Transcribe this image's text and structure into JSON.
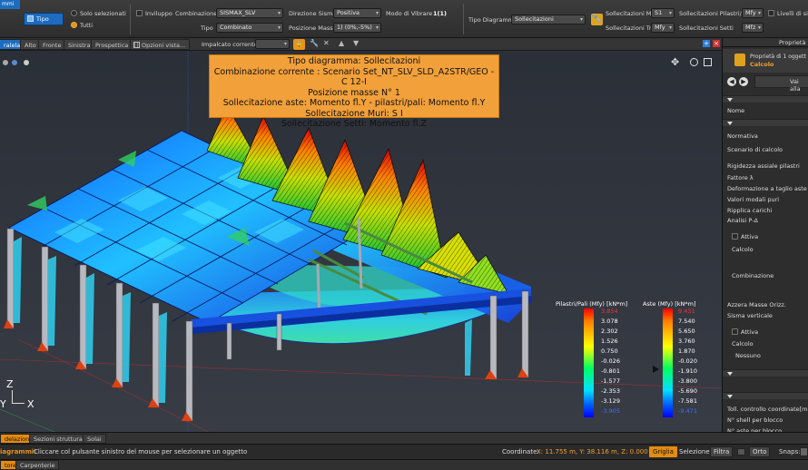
{
  "ribbon": {
    "corner_tab": "mmi",
    "tipo_button": "Tipo",
    "solo_selezionati": "Solo selezionati",
    "tutti": "Tutti",
    "inviluppo": "Inviluppo",
    "combinazione_label": "Combinazione",
    "combinazione_value": "SISMAX_SLV",
    "tipo_label": "Tipo",
    "tipo_value": "Combinato",
    "direzione_sisma_label": "Direzione Sisma",
    "direzione_sisma_value": "Positiva",
    "posizione_masse_label": "Posizione Masse",
    "posizione_masse_value": "1) (0%,-5%)",
    "modo_vibrare_label": "Modo di Vibrare",
    "modo_vibrare_value": "1(1)",
    "tipo_diagramma_label": "Tipo Diagramma",
    "tipo_diagramma_value": "Sollecitazioni",
    "sollecitazioni_muri_label": "Sollecitazioni Muri",
    "sollecitazioni_muri_value": "S1",
    "sollecitazioni_pilastri_label": "Sollecitazioni Pilastri/Pali",
    "sollecitazioni_pilastri_value": "Mfy",
    "livelli_sicurezza_label": "Livelli di sicurezz",
    "sollecitazioni_travi_label": "Sollecitazioni Travi",
    "sollecitazioni_travi_value": "Mfy",
    "sollecitazioni_setti_label": "Sollecitazioni Setti",
    "sollecitazioni_setti_value": "Mfz"
  },
  "viewbar": {
    "tabs": [
      "ralela",
      "Alto",
      "Fronte",
      "Sinistra",
      "Prospettica"
    ],
    "opzioni_vista": "Opzioni vista...",
    "impalcato_label": "Impalcato corrente:"
  },
  "infobox": {
    "lines": [
      "Tipo diagramma: Sollecitazioni",
      "Combinazione corrente : Scenario Set_NT_SLV_SLD_A2STR/GEO - C 12-I",
      "Posizione masse N° 1",
      "Sollecitazione aste: Momento fl.Y - pilastri/pali: Momento fl.Y",
      "Sollecitazione Muri: S I",
      "Sollecitazione Setti: Momento fl.Z"
    ]
  },
  "legend_pilastri": {
    "title": "Pilastri/Pali (Mfy) [kN*m]",
    "values": [
      "3.854",
      "3.078",
      "2.302",
      "1.526",
      "0.750",
      "-0.026",
      "-0.801",
      "-1.577",
      "-2.353",
      "-3.129",
      "-3.905"
    ]
  },
  "legend_aste": {
    "title": "Aste (Mfy) [kN*m]",
    "values": [
      "9.431",
      "7.540",
      "5.650",
      "3.760",
      "1.870",
      "-0.020",
      "-1.910",
      "-3.800",
      "-5.690",
      "-7.581",
      "-9.471"
    ]
  },
  "axes": {
    "z": "Z",
    "y": "Y",
    "x": "X"
  },
  "right_panel": {
    "tab": "Proprietà",
    "header_line1": "Proprietà di 1 oggett",
    "header_line2": "Calcolo",
    "vai_alla": "Vai alla",
    "rows": {
      "nome": "Nome",
      "normativa": "Normativa",
      "scenario": "Scenario di calcolo",
      "rigidezza": "Rigidezza assiale pilastri",
      "fattore": "Fattore λ",
      "deformazione": "Deformazione a taglio aste",
      "valori_modali": "Valori modali puri",
      "ripplica": "Ripplica carichi",
      "analisi": "Analisi P-Δ",
      "attiva1": "Attiva",
      "calcolo1": "Calcolo",
      "combinazione": "Combinazione",
      "azzera": "Azzera Masse Orizz.",
      "sisma": "Sisma verticale",
      "attiva2": "Attiva",
      "calcolo2": "Calcolo",
      "nessuno": "Nessuno",
      "toll": "Toll. controllo coordinate[m]",
      "shell": "N° shell per blocco",
      "aste": "N° aste per blocco"
    }
  },
  "bottom_tabs": [
    "delazione",
    "Sezioni strutturali",
    "Solai"
  ],
  "status": {
    "prefix": "iagrammi:",
    "message": "Cliccare col pulsante sinistro del mouse per selezionare un oggetto",
    "coord_label": "Coordinate:",
    "coord_value": "X: 11.755 m, Y: 38.116 m, Z: 0.000 m",
    "griglia": "Griglia",
    "selezione": "Selezione:",
    "filtra": "Filtra",
    "orto": "Orto",
    "snaps": "Snaps:"
  },
  "bottom_tabs2": [
    "tore",
    "Carpenterie"
  ]
}
